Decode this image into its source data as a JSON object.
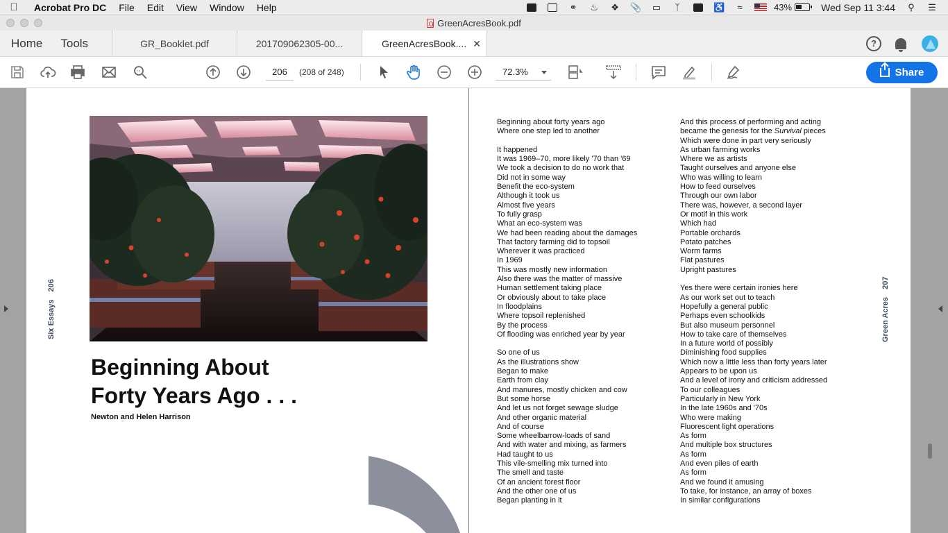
{
  "menubar": {
    "app_name": "Acrobat Pro DC",
    "menus": [
      "File",
      "Edit",
      "View",
      "Window",
      "Help"
    ],
    "battery": "43%",
    "clock": "Wed Sep 11  3:44"
  },
  "window": {
    "title": "GreenAcresBook.pdf"
  },
  "nav": {
    "home": "Home",
    "tools": "Tools"
  },
  "tabs": [
    {
      "label": "GR_Booklet.pdf"
    },
    {
      "label": "201709062305-00..."
    },
    {
      "label": "GreenAcresBook...."
    }
  ],
  "toolbar": {
    "page_current": "206",
    "page_count": "(208 of 248)",
    "zoom": "72.3%",
    "share_label": "Share"
  },
  "left_page": {
    "title_line1": "Beginning About",
    "title_line2": "Forty Years Ago . . .",
    "authors": "Newton and Helen Harrison",
    "runner_text": "Six Essays",
    "runner_num": "206"
  },
  "right_page": {
    "runner_text": "Green Acres",
    "runner_num": "207",
    "col1": [
      "Beginning about forty years ago",
      "Where one step led to another",
      "",
      "It happened",
      "It was 1969–70, more likely '70 than '69",
      "We took a decision to do no work that",
      "Did not in some way",
      "Benefit the eco-system",
      "Although it took us",
      "Almost five years",
      "To fully grasp",
      "What an eco-system was",
      "We had been reading about the damages",
      "That factory farming did to topsoil",
      "Wherever it was practiced",
      "In 1969",
      "This was mostly new information",
      "Also there was the matter of massive",
      "Human settlement taking place",
      "Or obviously about to take place",
      "In floodplains",
      "Where topsoil replenished",
      "By the process",
      "Of flooding was enriched year by year",
      "",
      "So one of us",
      "As the illustrations show",
      "Began to make",
      "Earth from clay",
      "And manures, mostly chicken and cow",
      "But some horse",
      "And let us not forget sewage sludge",
      "And other organic material",
      "And of course",
      "Some wheelbarrow-loads of sand",
      "And with water and mixing, as farmers",
      "Had taught to us",
      "This vile-smelling mix turned into",
      "The smell and taste",
      "Of an ancient forest floor",
      "And the other one of us",
      "Began planting in it"
    ],
    "col2": [
      "And this process of performing and acting",
      "became the genesis for the Survival pieces",
      "Which were done in part very seriously",
      "As urban farming works",
      "Where we as artists",
      "Taught ourselves and anyone else",
      "Who was willing to learn",
      "How to feed ourselves",
      "Through our own labor",
      "There was, however, a second layer",
      "Or motif in this work",
      "Which had",
      "Portable orchards",
      "Potato patches",
      "Worm farms",
      "Flat pastures",
      "Upright pastures",
      "",
      "Yes there were certain ironies here",
      "As our work set out to teach",
      "Hopefully a general public",
      "Perhaps even schoolkids",
      "But also museum personnel",
      "How to take care of themselves",
      "In a future world of possibly",
      "Diminishing food supplies",
      "Which now a little less than forty years later",
      "Appears to be upon us",
      "And a level of irony and criticism addressed",
      "To our colleagues",
      "Particularly in New York",
      "In the late 1960s and '70s",
      "Who were making",
      "Fluorescent light operations",
      "As form",
      "And multiple box structures",
      "As form",
      "And even piles of earth",
      "As form",
      "And we found it amusing",
      "To take, for instance, an array of boxes",
      "In similar configurations"
    ]
  }
}
